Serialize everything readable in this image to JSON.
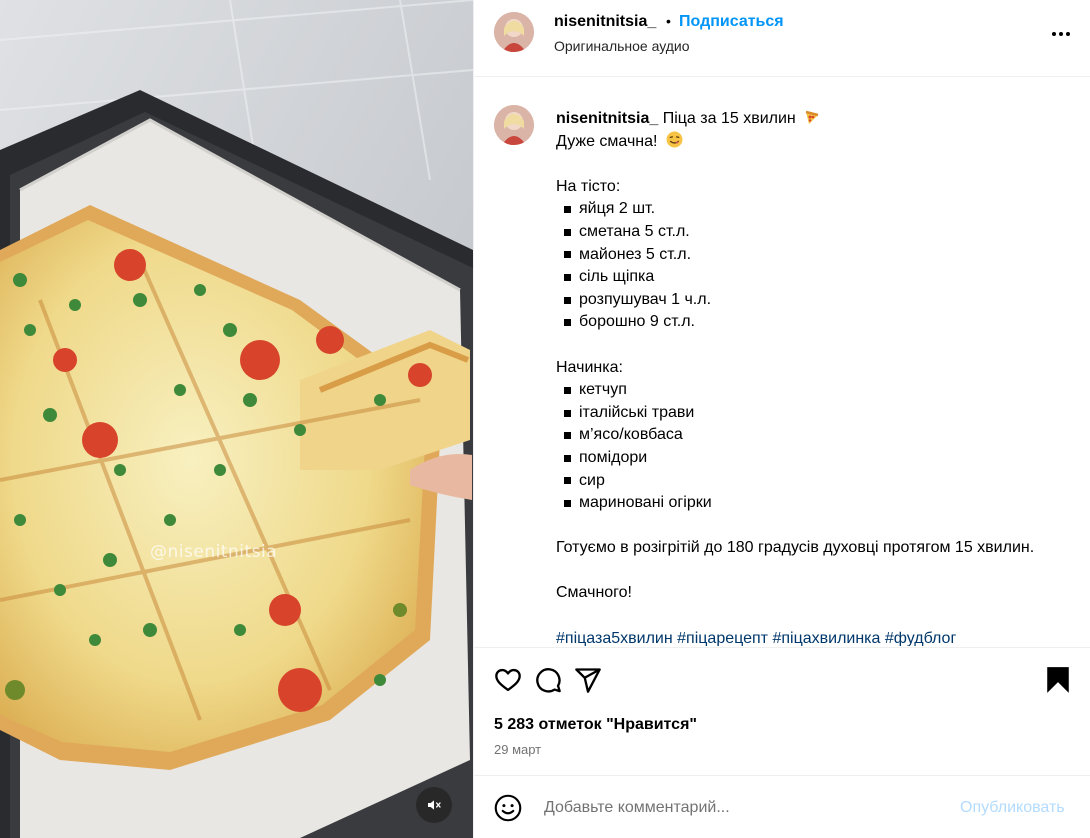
{
  "header": {
    "username": "nisenitnitsia_",
    "separator": "•",
    "follow_label": "Подписаться",
    "audio_label": "Оригинальное аудио"
  },
  "media": {
    "watermark": "@nisenitnitsia"
  },
  "caption": {
    "username": "nisenitnitsia_",
    "title": "Піца за 15 хвилин",
    "subtitle": "Дуже смачна!",
    "dough_heading": "На тісто:",
    "dough_items": [
      "яйця 2 шт.",
      "сметана 5 ст.л.",
      "майонез 5 ст.л.",
      "сіль щіпка",
      "розпушувач 1 ч.л.",
      "борошно 9 ст.л."
    ],
    "filling_heading": "Начинка:",
    "filling_items": [
      "кетчуп",
      "італійські трави",
      "м’ясо/ковбаса",
      "помідори",
      "сир",
      "мариновані огірки"
    ],
    "instructions": "Готуємо в розігрітій до 180 градусів духовці протягом 15 хвилин.",
    "closing": "Смачного!",
    "hashtags": [
      "#піцаза5хвилин",
      "#піцарецепт",
      "#піцахвилинка",
      "#фудблог"
    ]
  },
  "actions": {
    "likes": "5 283 отметок \"Нравится\"",
    "date": "29 март"
  },
  "comment": {
    "placeholder": "Добавьте комментарий...",
    "publish_label": "Опубликовать"
  },
  "icons": {
    "like": "heart-icon",
    "comment": "speech-bubble-icon",
    "share": "paper-plane-icon",
    "save": "bookmark-icon",
    "more": "ellipsis-icon",
    "emoji": "smiley-icon",
    "mute": "speaker-muted-icon"
  },
  "colors": {
    "accent": "#0095f6",
    "hashtag": "#00376b",
    "secondary_text": "#737373",
    "publish_disabled": "#b3dbff"
  }
}
